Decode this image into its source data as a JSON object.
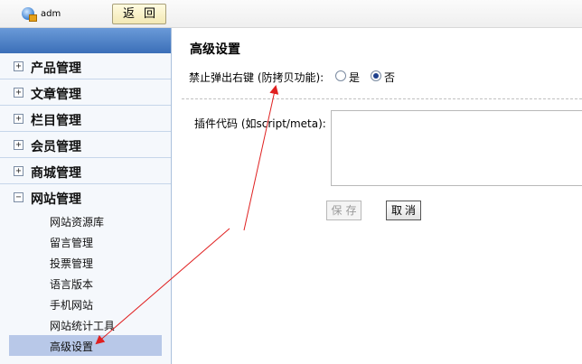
{
  "topbar": {
    "username": "adm",
    "back_label": "返回"
  },
  "sidebar": {
    "groups": [
      {
        "label": "产品管理",
        "toggle": "+"
      },
      {
        "label": "文章管理",
        "toggle": "+"
      },
      {
        "label": "栏目管理",
        "toggle": "+"
      },
      {
        "label": "会员管理",
        "toggle": "+"
      },
      {
        "label": "商城管理",
        "toggle": "+"
      },
      {
        "label": "网站管理",
        "toggle": "−"
      }
    ],
    "sub_items": [
      "网站资源库",
      "留言管理",
      "投票管理",
      "语言版本",
      "手机网站",
      "网站统计工具",
      "高级设置"
    ],
    "active_item": "高级设置"
  },
  "main": {
    "title": "高级设置",
    "right_click_label": "禁止弹出右键 (防拷贝功能):",
    "option_yes": "是",
    "option_no": "否",
    "selected": "否",
    "plugin_label": "插件代码 (如script/meta):",
    "plugin_value": "",
    "save_label": "保存",
    "cancel_label": "取消"
  },
  "colors": {
    "sidebar_header": "#3b6fb8",
    "active_item_bg": "#b8c8e8",
    "annotation_arrow": "#e02020"
  },
  "icons": {
    "user": "user-globe-icon",
    "expand": "plus-box-icon",
    "collapse": "minus-box-icon"
  }
}
